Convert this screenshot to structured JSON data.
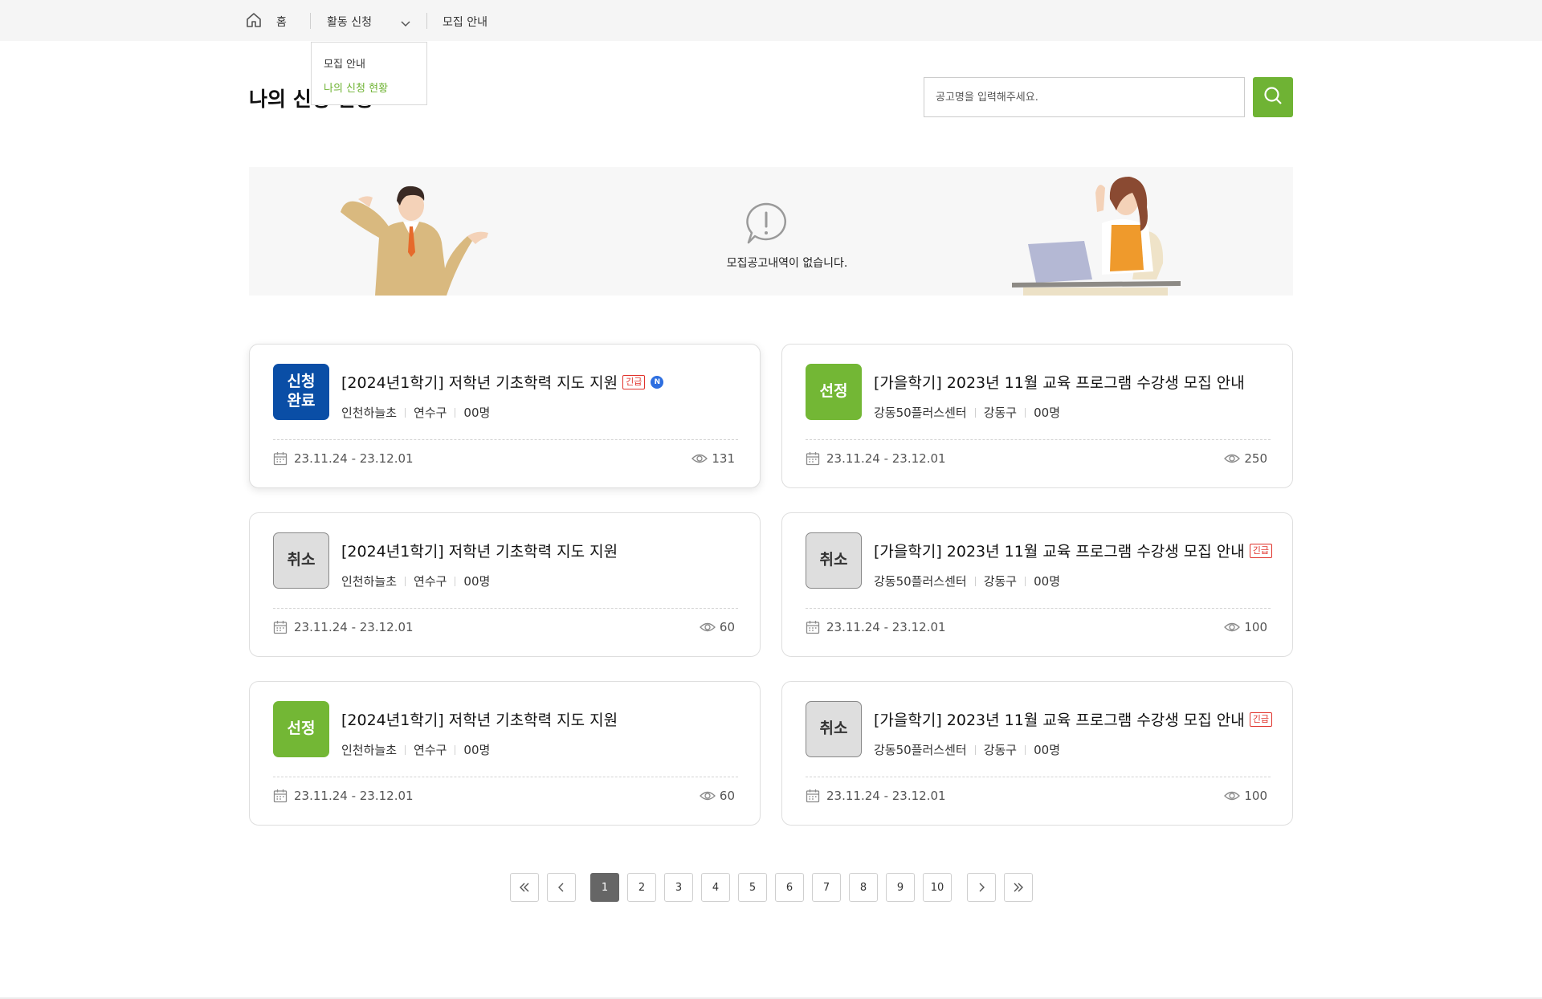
{
  "breadcrumb": {
    "home_label": "홈",
    "dropdown_label": "활동 신청",
    "last_label": "모집 안내"
  },
  "dropdown_menu": {
    "items": [
      {
        "label": "모집 안내",
        "active": false
      },
      {
        "label": "나의 신청 현황",
        "active": true
      }
    ]
  },
  "page": {
    "title": "나의 신청 현황"
  },
  "search": {
    "placeholder": "공고명을 입력해주세요."
  },
  "banner": {
    "message": "모집공고내역이 없습니다."
  },
  "cards": [
    {
      "badge": "신청\n완료",
      "status": "done",
      "title": "[2024년1학기] 저학년 기초학력 지도 지원",
      "urgent": "긴급",
      "new": "N",
      "org": "인천하늘초",
      "district": "연수구",
      "count": "00명",
      "date": "23.11.24 - 23.12.01",
      "views": "131"
    },
    {
      "badge": "선정",
      "status": "selected",
      "title": "[가을학기] 2023년 11월 교육 프로그램 수강생 모집 안내",
      "urgent": "",
      "new": "",
      "org": "강동50플러스센터",
      "district": "강동구",
      "count": "00명",
      "date": "23.11.24 - 23.12.01",
      "views": "250"
    },
    {
      "badge": "취소",
      "status": "cancel",
      "title": "[2024년1학기] 저학년 기초학력 지도 지원",
      "urgent": "",
      "new": "",
      "org": "인천하늘초",
      "district": "연수구",
      "count": "00명",
      "date": "23.11.24 - 23.12.01",
      "views": "60"
    },
    {
      "badge": "취소",
      "status": "cancel",
      "title": "[가을학기] 2023년 11월 교육 프로그램 수강생 모집 안내",
      "urgent": "긴급",
      "new": "",
      "org": "강동50플러스센터",
      "district": "강동구",
      "count": "00명",
      "date": "23.11.24 - 23.12.01",
      "views": "100"
    },
    {
      "badge": "선정",
      "status": "selected",
      "title": "[2024년1학기] 저학년 기초학력 지도 지원",
      "urgent": "",
      "new": "",
      "org": "인천하늘초",
      "district": "연수구",
      "count": "00명",
      "date": "23.11.24 - 23.12.01",
      "views": "60"
    },
    {
      "badge": "취소",
      "status": "cancel",
      "title": "[가을학기] 2023년 11월 교육 프로그램 수강생 모집 안내",
      "urgent": "긴급",
      "new": "",
      "org": "강동50플러스센터",
      "district": "강동구",
      "count": "00명",
      "date": "23.11.24 - 23.12.01",
      "views": "100"
    }
  ],
  "pagination": {
    "pages": [
      "1",
      "2",
      "3",
      "4",
      "5",
      "6",
      "7",
      "8",
      "9",
      "10"
    ],
    "current": "1"
  },
  "colors": {
    "accent_green": "#6fb334",
    "done_blue": "#0a4ea6",
    "urgent_red": "#e0322b",
    "new_blue": "#2e6fe0"
  }
}
